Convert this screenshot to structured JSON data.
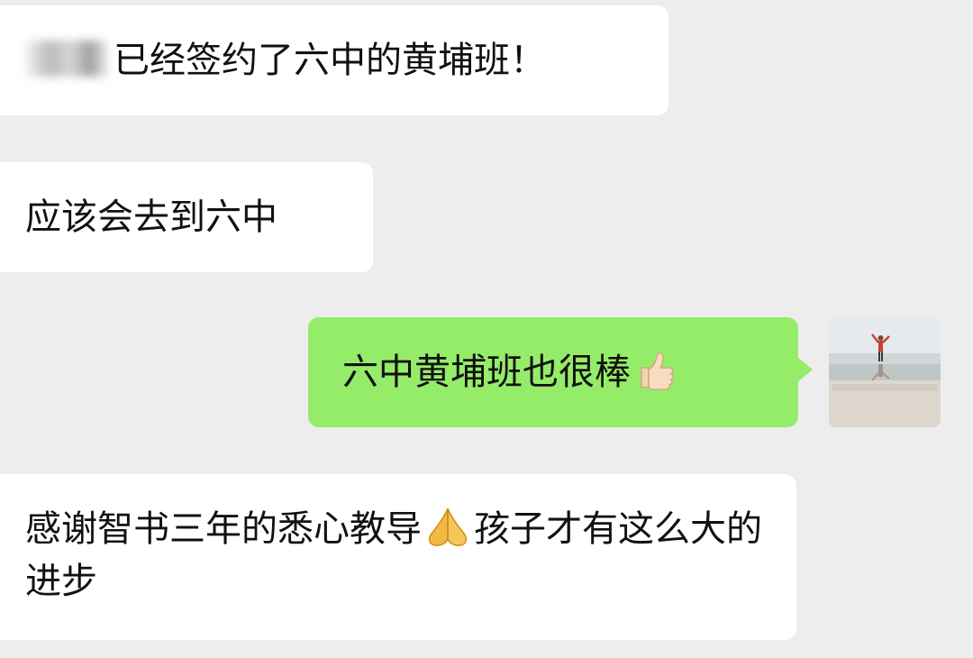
{
  "chat": {
    "messages": [
      {
        "side": "left",
        "text": "已经签约了六中的黄埔班！",
        "sender_obscured": true
      },
      {
        "side": "left",
        "text": "应该会去到六中"
      },
      {
        "side": "right",
        "text": "六中黄埔班也很棒",
        "emoji": "thumbs-up-icon"
      },
      {
        "side": "left",
        "text_before": "感谢智书三年的悉心教导",
        "emoji": "folded-hands-icon",
        "text_after": "孩子才有这么大的进步"
      }
    ]
  },
  "colors": {
    "background": "#ededed",
    "incoming_bubble": "#ffffff",
    "outgoing_bubble": "#95ec69",
    "text": "#111111"
  },
  "avatar": {
    "icon": "beach-person-avatar"
  }
}
